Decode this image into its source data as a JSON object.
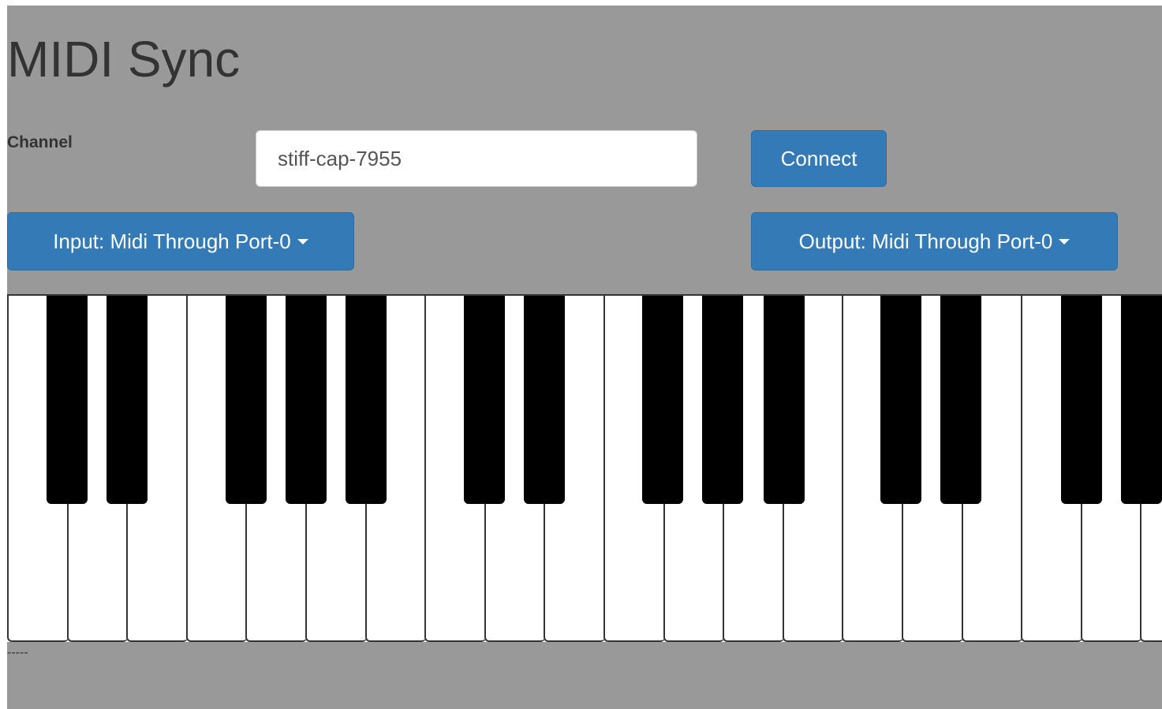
{
  "app": {
    "title": "MIDI Sync"
  },
  "channel": {
    "label": "Channel",
    "value": "stiff-cap-7955"
  },
  "buttons": {
    "connect_label": "Connect",
    "input_label": "Input: Midi Through Port-0",
    "output_label": "Output: Midi Through Port-0"
  },
  "keyboard": {
    "white_key_count": 20,
    "visible_black_keys": 14
  },
  "status": {
    "text": "-----"
  },
  "colors": {
    "background": "#999999",
    "button": "#337ab7",
    "white_key": "#ffffff",
    "black_key": "#000000"
  }
}
